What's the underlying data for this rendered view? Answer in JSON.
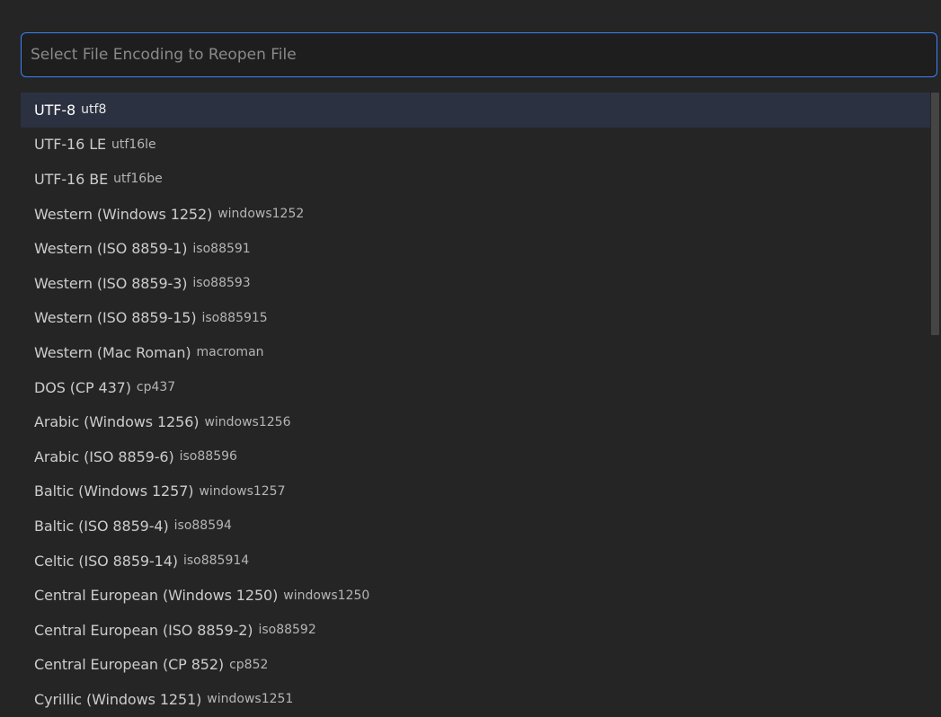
{
  "quick_pick": {
    "placeholder": "Select File Encoding to Reopen File",
    "items": [
      {
        "label": "UTF-8",
        "description": "utf8",
        "selected": true
      },
      {
        "label": "UTF-16 LE",
        "description": "utf16le"
      },
      {
        "label": "UTF-16 BE",
        "description": "utf16be"
      },
      {
        "label": "Western (Windows 1252)",
        "description": "windows1252"
      },
      {
        "label": "Western (ISO 8859-1)",
        "description": "iso88591"
      },
      {
        "label": "Western (ISO 8859-3)",
        "description": "iso88593"
      },
      {
        "label": "Western (ISO 8859-15)",
        "description": "iso885915"
      },
      {
        "label": "Western (Mac Roman)",
        "description": "macroman"
      },
      {
        "label": "DOS (CP 437)",
        "description": "cp437"
      },
      {
        "label": "Arabic (Windows 1256)",
        "description": "windows1256"
      },
      {
        "label": "Arabic (ISO 8859-6)",
        "description": "iso88596"
      },
      {
        "label": "Baltic (Windows 1257)",
        "description": "windows1257"
      },
      {
        "label": "Baltic (ISO 8859-4)",
        "description": "iso88594"
      },
      {
        "label": "Celtic (ISO 8859-14)",
        "description": "iso885914"
      },
      {
        "label": "Central European (Windows 1250)",
        "description": "windows1250"
      },
      {
        "label": "Central European (ISO 8859-2)",
        "description": "iso88592"
      },
      {
        "label": "Central European (CP 852)",
        "description": "cp852"
      },
      {
        "label": "Cyrillic (Windows 1251)",
        "description": "windows1251"
      }
    ]
  },
  "colors": {
    "background": "#252526",
    "input_border": "#3b82f6",
    "selected_row": "#2b3140",
    "text": "#cccccc"
  }
}
